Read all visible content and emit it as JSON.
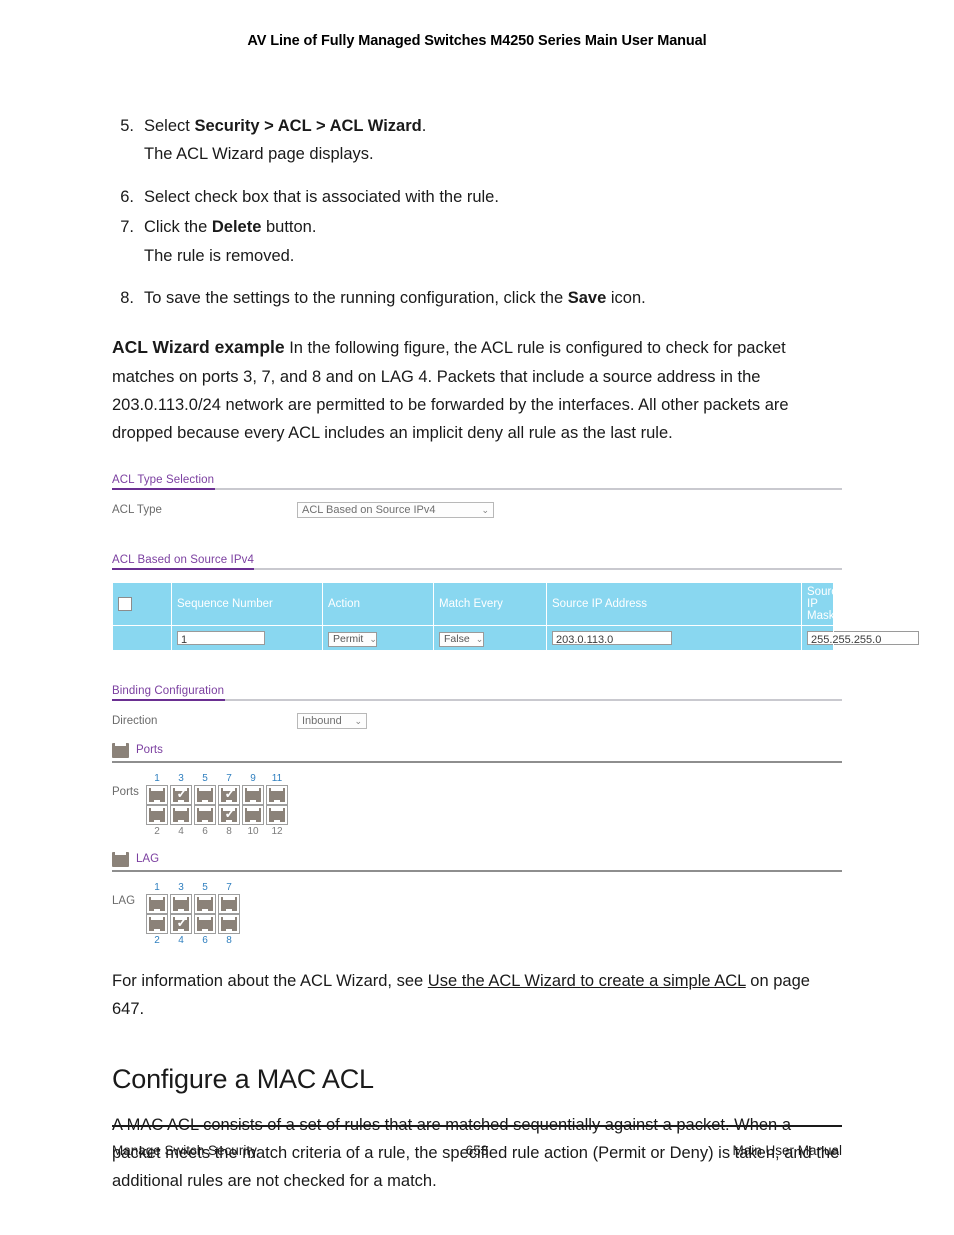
{
  "page_header": "AV Line of Fully Managed Switches M4250 Series Main User Manual",
  "steps": [
    {
      "num": "5.",
      "text_pre": "Select ",
      "bold": "Security > ACL > ACL Wizard",
      "text_post": ".",
      "sub": "The ACL Wizard page displays."
    },
    {
      "num": "6.",
      "text_pre": "Select check box that is associated with the rule.",
      "bold": "",
      "text_post": "",
      "sub": ""
    },
    {
      "num": "7.",
      "text_pre": "Click the ",
      "bold": "Delete",
      "text_post": " button.",
      "sub": "The rule is removed."
    },
    {
      "num": "8.",
      "text_pre": "To save the settings to the running configuration, click the ",
      "bold": "Save",
      "text_post": " icon.",
      "sub": ""
    }
  ],
  "example": {
    "lead": "ACL Wizard example",
    "body": " In the following figure, the ACL rule is configured to check for packet matches on ports 3, 7, and 8 and on LAG 4. Packets that include a source address in the 203.0.113.0/24 network are permitted to be forwarded by the interfaces. All other packets are dropped because every ACL includes an implicit deny all rule as the last rule."
  },
  "figure": {
    "acl_type_selection": {
      "section_title": "ACL Type Selection",
      "field_label": "ACL Type",
      "field_value": "ACL Based on Source IPv4",
      "caret": "⌄"
    },
    "acl_table": {
      "section_title": "ACL Based on Source IPv4",
      "headers": [
        "",
        "Sequence Number",
        "Action",
        "Match Every",
        "Source IP Address",
        "Source IP Mask"
      ],
      "row": {
        "sequence_number": "1",
        "action": "Permit",
        "match_every": "False",
        "source_ip_address": "203.0.113.0",
        "source_ip_mask": "255.255.255.0"
      },
      "header_bg": "#89d7f0",
      "header_fg": "#ffffff"
    },
    "binding": {
      "section_title": "Binding Configuration",
      "direction_label": "Direction",
      "direction_value": "Inbound",
      "ports_group_title": "Ports",
      "ports_matrix_label": "Ports",
      "ports_top_numbers": [
        "1",
        "3",
        "5",
        "7",
        "9",
        "11"
      ],
      "ports_bottom_numbers": [
        "2",
        "4",
        "6",
        "8",
        "10",
        "12"
      ],
      "ports_top_selected": [
        false,
        true,
        false,
        true,
        false,
        false
      ],
      "ports_bottom_selected": [
        false,
        false,
        false,
        true,
        false,
        false
      ],
      "lag_group_title": "LAG",
      "lag_matrix_label": "LAG",
      "lag_top_numbers": [
        "1",
        "3",
        "5",
        "7"
      ],
      "lag_bottom_numbers": [
        "2",
        "4",
        "6",
        "8"
      ],
      "lag_top_selected": [
        false,
        false,
        false,
        false
      ],
      "lag_bottom_selected": [
        false,
        true,
        false,
        false
      ],
      "check_glyph": "✓"
    },
    "accent_purple": "#6a2f91",
    "jack_color": "#8b8279"
  },
  "after_figure": {
    "pre": "For information about the ACL Wizard, see ",
    "link": "Use the ACL Wizard to create a simple ACL",
    "post": " on page 647."
  },
  "mac_acl": {
    "heading": "Configure a MAC ACL",
    "body": "A MAC ACL consists of a set of rules that are matched sequentially against a packet. When a packet meets the match criteria of a rule, the specified rule action (Permit or Deny) is taken, and the additional rules are not checked for a match."
  },
  "footer": {
    "left": "Manage Switch Security",
    "page_number": "653",
    "right": "Main User Manual"
  }
}
